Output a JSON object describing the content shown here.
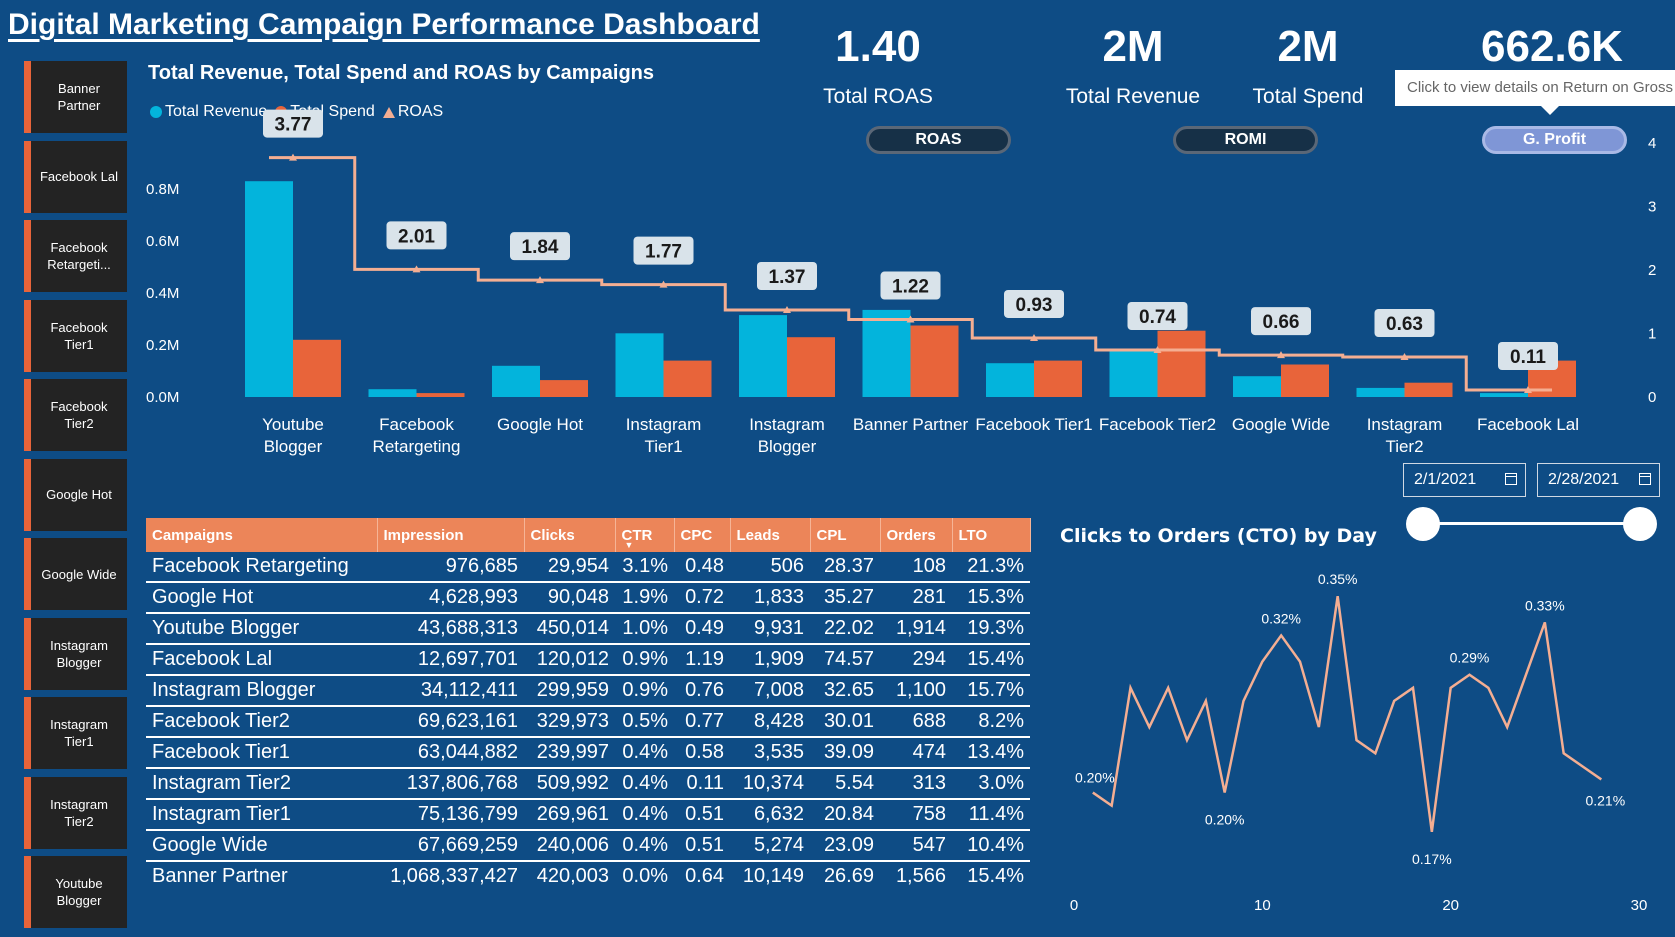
{
  "header": {
    "title": "Digital Marketing Campaign Performance Dashboard"
  },
  "sidebar": {
    "items": [
      {
        "label": "Banner Partner"
      },
      {
        "label": "Facebook Lal"
      },
      {
        "label": "Facebook Retargeti..."
      },
      {
        "label": "Facebook Tier1"
      },
      {
        "label": "Facebook Tier2"
      },
      {
        "label": "Google Hot"
      },
      {
        "label": "Google Wide"
      },
      {
        "label": "Instagram Blogger"
      },
      {
        "label": "Instagram Tier1"
      },
      {
        "label": "Instagram Tier2"
      },
      {
        "label": "Youtube Blogger"
      }
    ]
  },
  "kpis": [
    {
      "value": "1.40",
      "label": "Total ROAS"
    },
    {
      "value": "2M",
      "label": "Total Revenue"
    },
    {
      "value": "2M",
      "label": "Total Spend"
    },
    {
      "value": "662.6K",
      "label": ""
    }
  ],
  "buttons": {
    "roas": "ROAS",
    "romi": "ROMI",
    "gprofit": "G. Profit"
  },
  "tooltip": {
    "text": "Click to view details on Return on Gross Profit"
  },
  "colors": {
    "revenue": "#03b4dc",
    "spend": "#e8643a",
    "roas": "#f4ae92",
    "background": "#0e4c85"
  },
  "table": {
    "columns": [
      "Campaigns",
      "Impression",
      "Clicks",
      "CTR",
      "CPC",
      "Leads",
      "CPL",
      "Orders",
      "LTO"
    ],
    "rows": [
      [
        "Facebook Retargeting",
        "976,685",
        "29,954",
        "3.1%",
        "0.48",
        "506",
        "28.37",
        "108",
        "21.3%"
      ],
      [
        "Google Hot",
        "4,628,993",
        "90,048",
        "1.9%",
        "0.72",
        "1,833",
        "35.27",
        "281",
        "15.3%"
      ],
      [
        "Youtube Blogger",
        "43,688,313",
        "450,014",
        "1.0%",
        "0.49",
        "9,931",
        "22.02",
        "1,914",
        "19.3%"
      ],
      [
        "Facebook Lal",
        "12,697,701",
        "120,012",
        "0.9%",
        "1.19",
        "1,909",
        "74.57",
        "294",
        "15.4%"
      ],
      [
        "Instagram Blogger",
        "34,112,411",
        "299,959",
        "0.9%",
        "0.76",
        "7,008",
        "32.65",
        "1,100",
        "15.7%"
      ],
      [
        "Facebook Tier2",
        "69,623,161",
        "329,973",
        "0.5%",
        "0.77",
        "8,428",
        "30.01",
        "688",
        "8.2%"
      ],
      [
        "Facebook Tier1",
        "63,044,882",
        "239,997",
        "0.4%",
        "0.58",
        "3,535",
        "39.09",
        "474",
        "13.4%"
      ],
      [
        "Instagram Tier2",
        "137,806,768",
        "509,992",
        "0.4%",
        "0.11",
        "10,374",
        "5.54",
        "313",
        "3.0%"
      ],
      [
        "Instagram Tier1",
        "75,136,799",
        "269,961",
        "0.4%",
        "0.51",
        "6,632",
        "20.84",
        "758",
        "11.4%"
      ],
      [
        "Google Wide",
        "67,669,259",
        "240,006",
        "0.4%",
        "0.51",
        "5,274",
        "23.09",
        "547",
        "10.4%"
      ],
      [
        "Banner Partner",
        "1,068,337,427",
        "420,003",
        "0.0%",
        "0.64",
        "10,149",
        "26.69",
        "1,566",
        "15.4%"
      ]
    ]
  },
  "date_slicer": {
    "start": "2/1/2021",
    "end": "2/28/2021",
    "start_pos": 0,
    "end_pos": 1
  },
  "chart_data": [
    {
      "type": "bar",
      "title": "Total Revenue, Total Spend and ROAS by Campaigns",
      "legend": [
        "Total Revenue",
        "Total Spend",
        "ROAS"
      ],
      "legend_position": "top-left",
      "categories": [
        "Youtube\nBlogger",
        "Facebook\nRetargeting",
        "Google Hot",
        "Instagram\nTier1",
        "Instagram\nBlogger",
        "Banner Partner",
        "Facebook Tier1",
        "Facebook Tier2",
        "Google Wide",
        "Instagram\nTier2",
        "Facebook Lal"
      ],
      "series": [
        {
          "name": "Total Revenue",
          "type": "bar",
          "axis": "left",
          "values": [
            830000,
            30000,
            120000,
            245000,
            315000,
            335000,
            130000,
            180000,
            80000,
            35000,
            15000
          ]
        },
        {
          "name": "Total Spend",
          "type": "bar",
          "axis": "left",
          "values": [
            220000,
            15000,
            65000,
            140000,
            230000,
            275000,
            140000,
            255000,
            125000,
            55000,
            140000
          ]
        },
        {
          "name": "ROAS",
          "type": "line",
          "axis": "right",
          "values": [
            3.77,
            2.01,
            1.84,
            1.77,
            1.37,
            1.22,
            0.93,
            0.74,
            0.66,
            0.63,
            0.11
          ]
        }
      ],
      "data_labels": [
        "3.77",
        "2.01",
        "1.84",
        "1.77",
        "1.37",
        "1.22",
        "0.93",
        "0.74",
        "0.66",
        "0.63",
        "0.11"
      ],
      "y_ticks": [
        "0.0M",
        "0.2M",
        "0.4M",
        "0.6M",
        "0.8M"
      ],
      "ylim": [
        0,
        900000
      ],
      "y2_ticks": [
        "0",
        "1",
        "2",
        "3",
        "4"
      ],
      "y2lim": [
        0,
        4.3
      ],
      "grid": false
    },
    {
      "type": "line",
      "title": "Clicks to Orders (CTO) by Day",
      "x": [
        1,
        2,
        3,
        4,
        5,
        6,
        7,
        8,
        9,
        10,
        11,
        12,
        13,
        14,
        15,
        16,
        17,
        18,
        19,
        20,
        21,
        22,
        23,
        24,
        25,
        26,
        27,
        28
      ],
      "values": [
        0.2,
        0.19,
        0.28,
        0.25,
        0.28,
        0.24,
        0.27,
        0.2,
        0.27,
        0.3,
        0.32,
        0.3,
        0.25,
        0.35,
        0.24,
        0.23,
        0.27,
        0.28,
        0.17,
        0.28,
        0.29,
        0.28,
        0.25,
        0.29,
        0.33,
        0.23,
        0.22,
        0.21
      ],
      "point_labels": [
        {
          "index": 0,
          "text": "0.20%"
        },
        {
          "index": 7,
          "text": "0.20%"
        },
        {
          "index": 10,
          "text": "0.32%"
        },
        {
          "index": 13,
          "text": "0.35%"
        },
        {
          "index": 18,
          "text": "0.17%"
        },
        {
          "index": 20,
          "text": "0.29%"
        },
        {
          "index": 24,
          "text": "0.33%"
        },
        {
          "index": 27,
          "text": "0.21%"
        }
      ],
      "x_ticks": [
        "0",
        "10",
        "20",
        "30"
      ],
      "xlim": [
        0,
        30
      ],
      "ylim": [
        0.15,
        0.37
      ],
      "grid": false
    }
  ]
}
